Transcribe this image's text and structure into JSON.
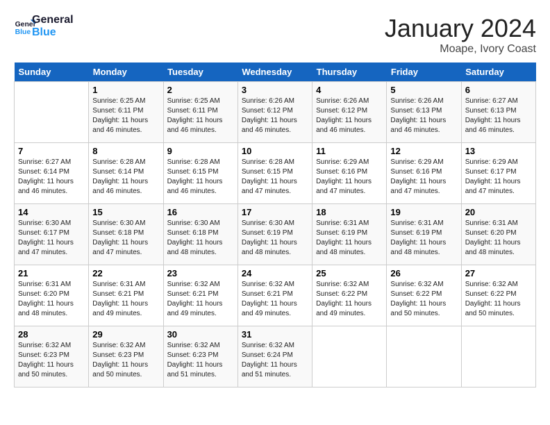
{
  "header": {
    "logo_line1": "General",
    "logo_line2": "Blue",
    "title": "January 2024",
    "subtitle": "Moape, Ivory Coast"
  },
  "days_of_week": [
    "Sunday",
    "Monday",
    "Tuesday",
    "Wednesday",
    "Thursday",
    "Friday",
    "Saturday"
  ],
  "weeks": [
    [
      {
        "day": "",
        "content": ""
      },
      {
        "day": "1",
        "content": "Sunrise: 6:25 AM\nSunset: 6:11 PM\nDaylight: 11 hours and 46 minutes."
      },
      {
        "day": "2",
        "content": "Sunrise: 6:25 AM\nSunset: 6:11 PM\nDaylight: 11 hours and 46 minutes."
      },
      {
        "day": "3",
        "content": "Sunrise: 6:26 AM\nSunset: 6:12 PM\nDaylight: 11 hours and 46 minutes."
      },
      {
        "day": "4",
        "content": "Sunrise: 6:26 AM\nSunset: 6:12 PM\nDaylight: 11 hours and 46 minutes."
      },
      {
        "day": "5",
        "content": "Sunrise: 6:26 AM\nSunset: 6:13 PM\nDaylight: 11 hours and 46 minutes."
      },
      {
        "day": "6",
        "content": "Sunrise: 6:27 AM\nSunset: 6:13 PM\nDaylight: 11 hours and 46 minutes."
      }
    ],
    [
      {
        "day": "7",
        "content": "Sunrise: 6:27 AM\nSunset: 6:14 PM\nDaylight: 11 hours and 46 minutes."
      },
      {
        "day": "8",
        "content": "Sunrise: 6:28 AM\nSunset: 6:14 PM\nDaylight: 11 hours and 46 minutes."
      },
      {
        "day": "9",
        "content": "Sunrise: 6:28 AM\nSunset: 6:15 PM\nDaylight: 11 hours and 46 minutes."
      },
      {
        "day": "10",
        "content": "Sunrise: 6:28 AM\nSunset: 6:15 PM\nDaylight: 11 hours and 47 minutes."
      },
      {
        "day": "11",
        "content": "Sunrise: 6:29 AM\nSunset: 6:16 PM\nDaylight: 11 hours and 47 minutes."
      },
      {
        "day": "12",
        "content": "Sunrise: 6:29 AM\nSunset: 6:16 PM\nDaylight: 11 hours and 47 minutes."
      },
      {
        "day": "13",
        "content": "Sunrise: 6:29 AM\nSunset: 6:17 PM\nDaylight: 11 hours and 47 minutes."
      }
    ],
    [
      {
        "day": "14",
        "content": "Sunrise: 6:30 AM\nSunset: 6:17 PM\nDaylight: 11 hours and 47 minutes."
      },
      {
        "day": "15",
        "content": "Sunrise: 6:30 AM\nSunset: 6:18 PM\nDaylight: 11 hours and 47 minutes."
      },
      {
        "day": "16",
        "content": "Sunrise: 6:30 AM\nSunset: 6:18 PM\nDaylight: 11 hours and 48 minutes."
      },
      {
        "day": "17",
        "content": "Sunrise: 6:30 AM\nSunset: 6:19 PM\nDaylight: 11 hours and 48 minutes."
      },
      {
        "day": "18",
        "content": "Sunrise: 6:31 AM\nSunset: 6:19 PM\nDaylight: 11 hours and 48 minutes."
      },
      {
        "day": "19",
        "content": "Sunrise: 6:31 AM\nSunset: 6:19 PM\nDaylight: 11 hours and 48 minutes."
      },
      {
        "day": "20",
        "content": "Sunrise: 6:31 AM\nSunset: 6:20 PM\nDaylight: 11 hours and 48 minutes."
      }
    ],
    [
      {
        "day": "21",
        "content": "Sunrise: 6:31 AM\nSunset: 6:20 PM\nDaylight: 11 hours and 48 minutes."
      },
      {
        "day": "22",
        "content": "Sunrise: 6:31 AM\nSunset: 6:21 PM\nDaylight: 11 hours and 49 minutes."
      },
      {
        "day": "23",
        "content": "Sunrise: 6:32 AM\nSunset: 6:21 PM\nDaylight: 11 hours and 49 minutes."
      },
      {
        "day": "24",
        "content": "Sunrise: 6:32 AM\nSunset: 6:21 PM\nDaylight: 11 hours and 49 minutes."
      },
      {
        "day": "25",
        "content": "Sunrise: 6:32 AM\nSunset: 6:22 PM\nDaylight: 11 hours and 49 minutes."
      },
      {
        "day": "26",
        "content": "Sunrise: 6:32 AM\nSunset: 6:22 PM\nDaylight: 11 hours and 50 minutes."
      },
      {
        "day": "27",
        "content": "Sunrise: 6:32 AM\nSunset: 6:22 PM\nDaylight: 11 hours and 50 minutes."
      }
    ],
    [
      {
        "day": "28",
        "content": "Sunrise: 6:32 AM\nSunset: 6:23 PM\nDaylight: 11 hours and 50 minutes."
      },
      {
        "day": "29",
        "content": "Sunrise: 6:32 AM\nSunset: 6:23 PM\nDaylight: 11 hours and 50 minutes."
      },
      {
        "day": "30",
        "content": "Sunrise: 6:32 AM\nSunset: 6:23 PM\nDaylight: 11 hours and 51 minutes."
      },
      {
        "day": "31",
        "content": "Sunrise: 6:32 AM\nSunset: 6:24 PM\nDaylight: 11 hours and 51 minutes."
      },
      {
        "day": "",
        "content": ""
      },
      {
        "day": "",
        "content": ""
      },
      {
        "day": "",
        "content": ""
      }
    ]
  ]
}
